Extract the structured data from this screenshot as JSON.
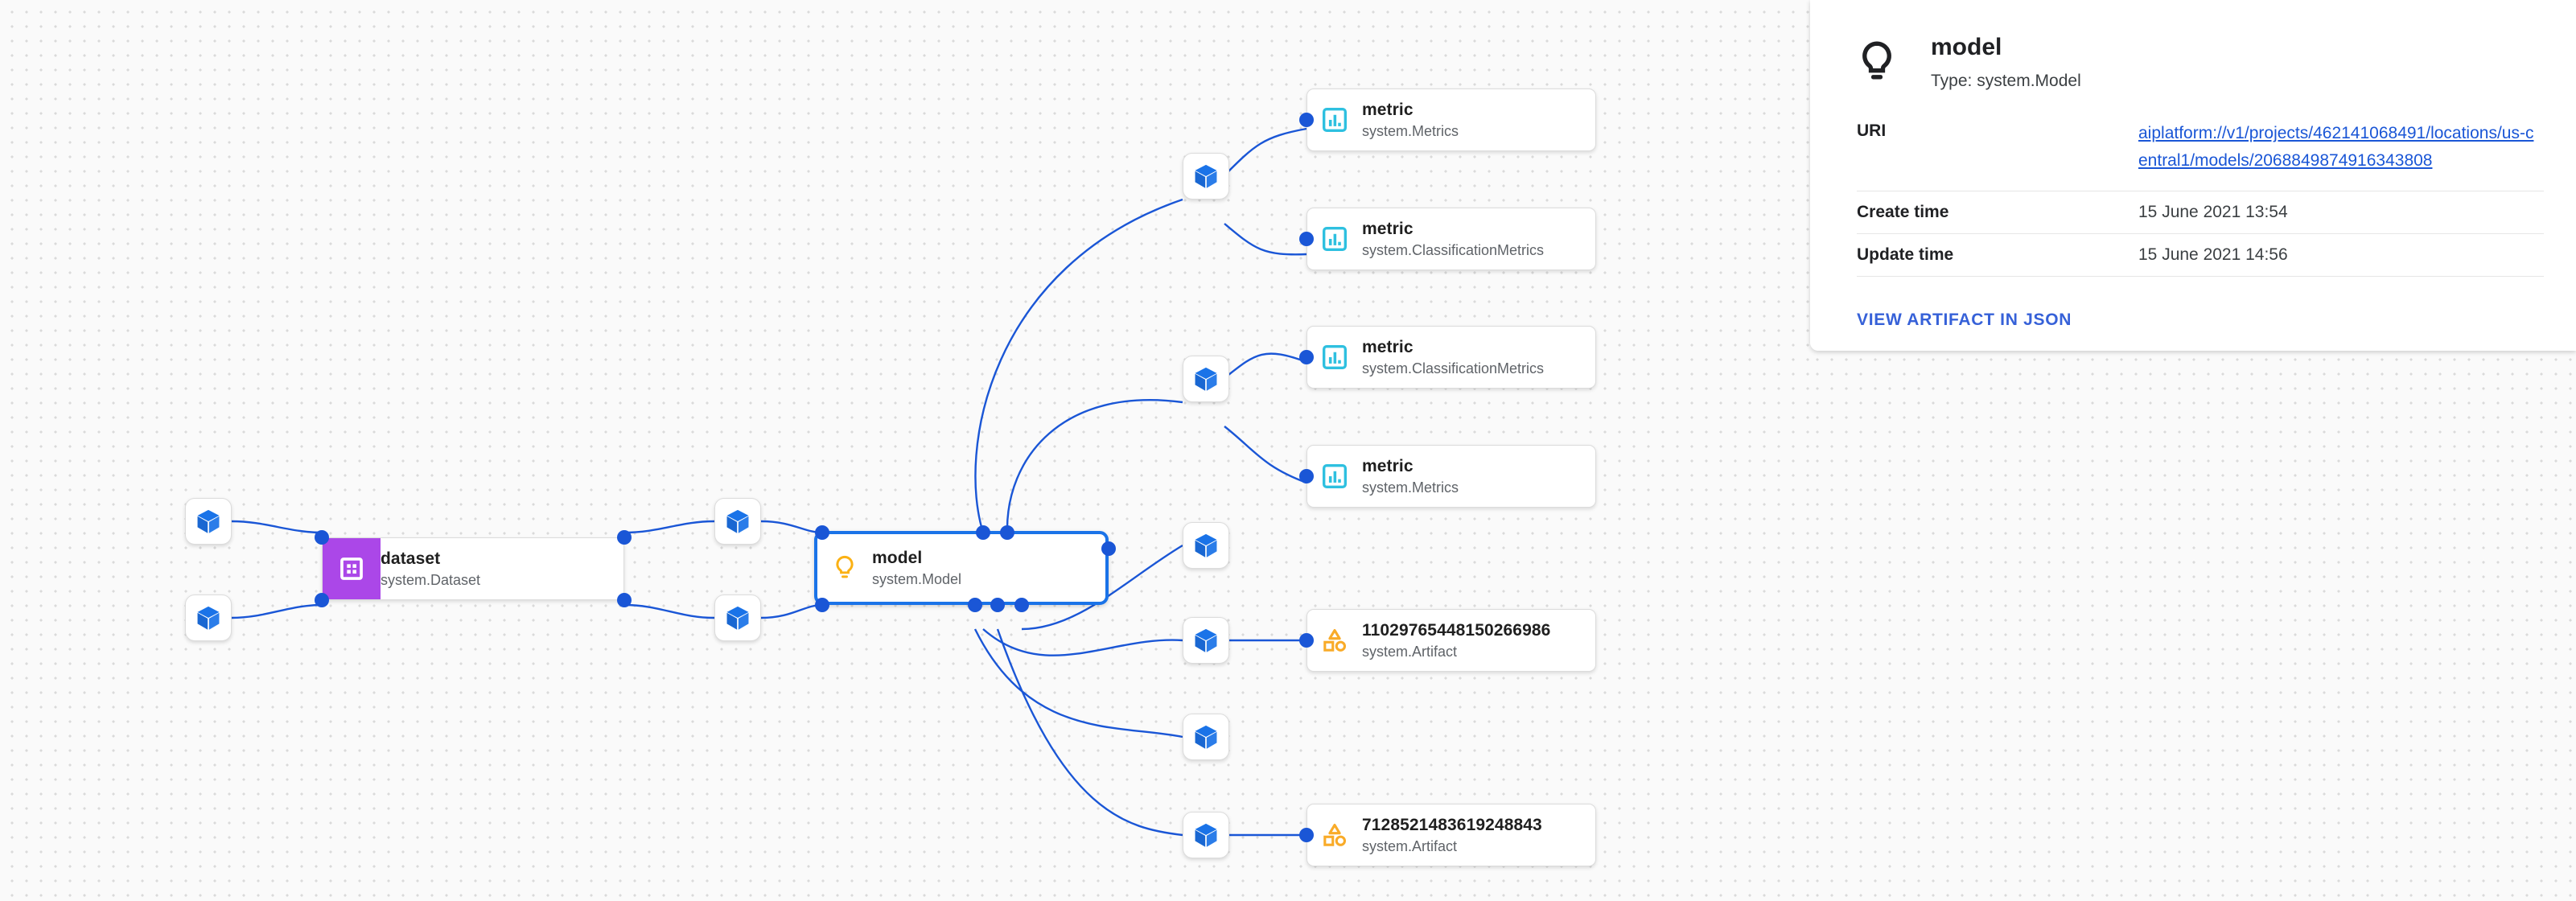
{
  "canvas": {
    "background_color": "#fafafa",
    "dot_color": "#dadada",
    "edge_color": "#1a56d6"
  },
  "graph": {
    "executions": [
      {
        "name": "execution-left-top",
        "icon": "cube-icon"
      },
      {
        "name": "execution-left-bottom",
        "icon": "cube-icon"
      },
      {
        "name": "execution-mid-top",
        "icon": "cube-icon"
      },
      {
        "name": "execution-mid-bottom",
        "icon": "cube-icon"
      },
      {
        "name": "execution-metrics-1",
        "icon": "cube-icon"
      },
      {
        "name": "execution-metrics-2",
        "icon": "cube-icon"
      },
      {
        "name": "execution-out-1",
        "icon": "cube-icon"
      },
      {
        "name": "execution-out-2",
        "icon": "cube-icon"
      },
      {
        "name": "execution-out-3",
        "icon": "cube-icon"
      },
      {
        "name": "execution-out-4",
        "icon": "cube-icon"
      }
    ],
    "dataset_node": {
      "title": "dataset",
      "subtitle": "system.Dataset",
      "icon": "dataset-grid-icon",
      "icon_bg": "#ab47e8"
    },
    "model_node": {
      "title": "model",
      "subtitle": "system.Model",
      "icon": "lightbulb-icon",
      "icon_color": "#fbb davvero",
      "selected": true,
      "border_color": "#1a73e8"
    },
    "artifact_nodes": [
      {
        "title": "metric",
        "subtitle": "system.Metrics",
        "icon": "metrics-bar-icon",
        "icon_color": "#2ec0e0"
      },
      {
        "title": "metric",
        "subtitle": "system.ClassificationMetrics",
        "icon": "metrics-bar-icon",
        "icon_color": "#2ec0e0"
      },
      {
        "title": "metric",
        "subtitle": "system.ClassificationMetrics",
        "icon": "metrics-bar-icon",
        "icon_color": "#2ec0e0"
      },
      {
        "title": "metric",
        "subtitle": "system.Metrics",
        "icon": "metrics-bar-icon",
        "icon_color": "#2ec0e0"
      },
      {
        "title": "11029765448150266986",
        "subtitle": "system.Artifact",
        "icon": "artifact-shapes-icon",
        "icon_color": "#f9ab28"
      },
      {
        "title": "7128521483619248843",
        "subtitle": "system.Artifact",
        "icon": "artifact-shapes-icon",
        "icon_color": "#f9ab28"
      }
    ]
  },
  "panel": {
    "icon": "lightbulb-icon",
    "title": "model",
    "type_label": "Type: system.Model",
    "rows": [
      {
        "key": "URI",
        "value": "aiplatform://v1/projects/462141068491/locations/us-central1/models/2068849874916343808",
        "is_link": true
      },
      {
        "key": "Create time",
        "value": "15 June 2021 13:54",
        "is_link": false
      },
      {
        "key": "Update time",
        "value": "15 June 2021 14:56",
        "is_link": false
      }
    ],
    "action_label": "VIEW ARTIFACT IN JSON",
    "action_color": "#3661d8"
  }
}
